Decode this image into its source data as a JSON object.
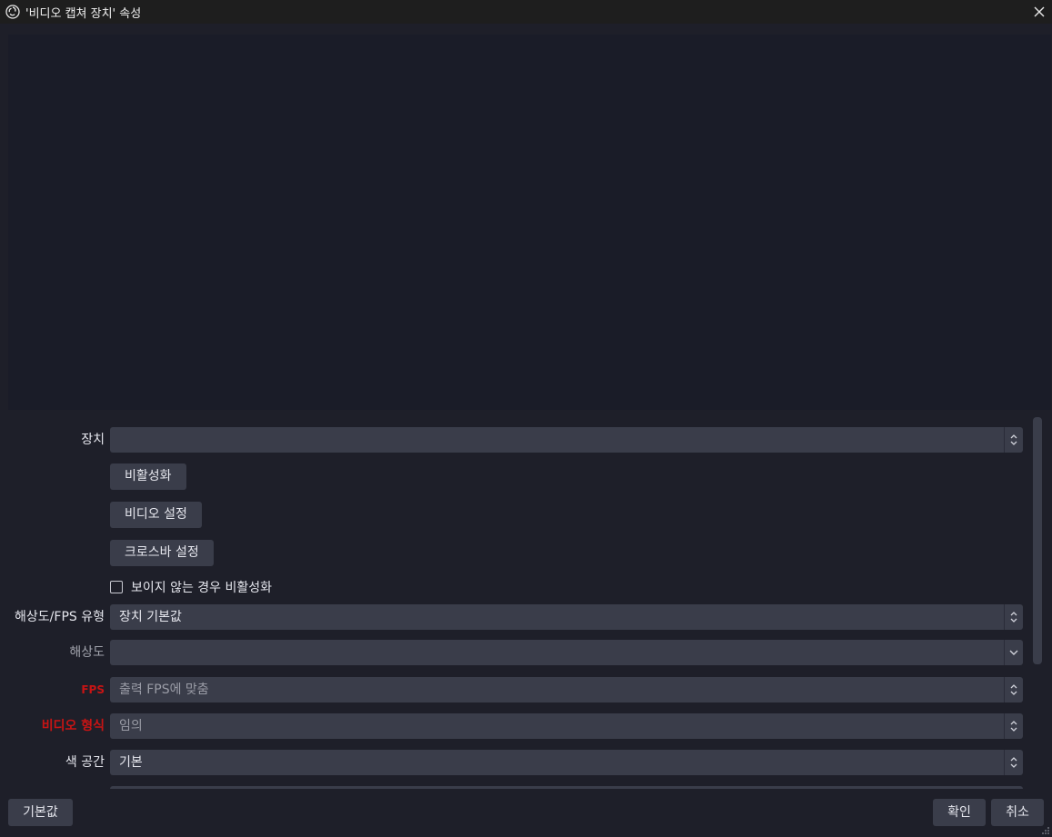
{
  "window": {
    "title": "'비디오 캡쳐 장치' 속성"
  },
  "icons": {
    "app": "obs-logo-icon",
    "close": "close-icon",
    "spinner": "up-down-arrows-icon",
    "dropdown": "chevron-down-icon",
    "resize": "resize-grip-icon"
  },
  "form": {
    "device": {
      "label": "장치",
      "value": ""
    },
    "buttons": {
      "deactivate": "비활성화",
      "video_settings": "비디오 설정",
      "crossbar_settings": "크로스바 설정"
    },
    "deactivate_when_hidden": {
      "label": "보이지 않는 경우 비활성화",
      "checked": false
    },
    "res_fps_type": {
      "label": "해상도/FPS 유형",
      "value": "장치 기본값"
    },
    "resolution": {
      "label": "해상도",
      "value": ""
    },
    "fps": {
      "label": "FPS",
      "value": "출력 FPS에 맞춤"
    },
    "video_format": {
      "label": "비디오 형식",
      "value": "임의"
    },
    "color_space": {
      "label": "색 공간",
      "value": "기본"
    }
  },
  "footer": {
    "defaults": "기본값",
    "ok": "확인",
    "cancel": "취소"
  },
  "colors": {
    "background": "#1e1f29",
    "control": "#3a3d4a",
    "warning_label": "#c81414"
  }
}
